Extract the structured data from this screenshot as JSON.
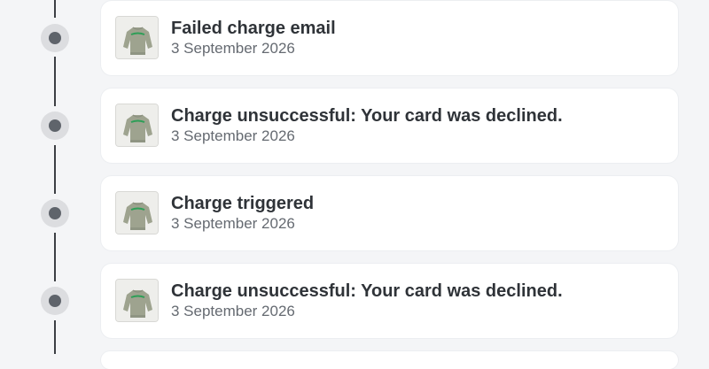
{
  "timeline": {
    "events": [
      {
        "title": "Failed charge email",
        "date": "3 September 2026",
        "icon": "sweatshirt-product-image"
      },
      {
        "title": "Charge unsuccessful: Your card was declined.",
        "date": "3 September 2026",
        "icon": "sweatshirt-product-image"
      },
      {
        "title": "Charge triggered",
        "date": "3 September 2026",
        "icon": "sweatshirt-product-image"
      },
      {
        "title": "Charge unsuccessful: Your card was declined.",
        "date": "3 September 2026",
        "icon": "sweatshirt-product-image"
      }
    ]
  },
  "colors": {
    "background": "#f4f5f7",
    "card": "#ffffff",
    "timeline_line": "#3c3f44",
    "timeline_node": "#5f646b",
    "product_green": "#2e9e57"
  }
}
